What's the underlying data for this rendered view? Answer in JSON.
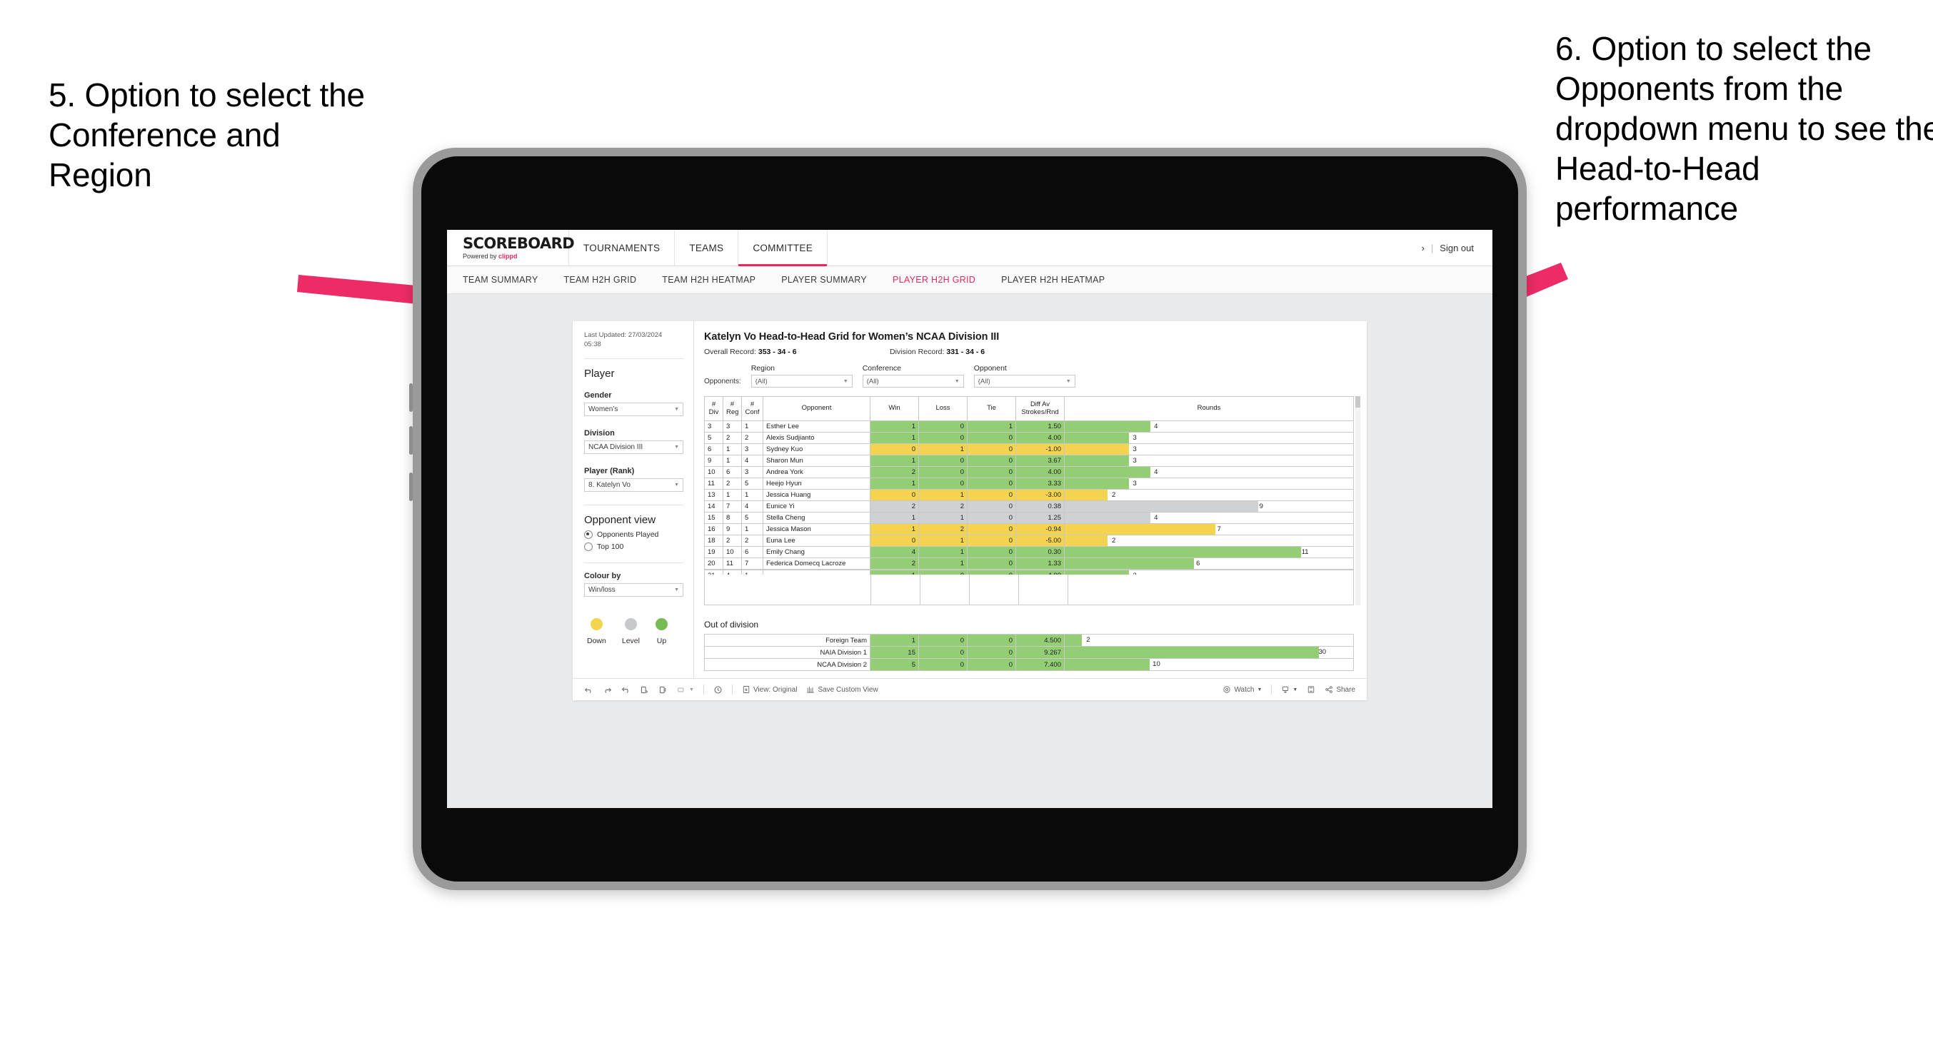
{
  "annotations": {
    "left": "5. Option to select the Conference and Region",
    "right": "6. Option to select the Opponents from the dropdown menu to see the Head-to-Head performance",
    "arrow_color": "#ED2C67"
  },
  "appbar": {
    "logo": "SCOREBOARD",
    "logo_sub_prefix": "Powered by ",
    "logo_sub_brand": "clippd",
    "nav": [
      {
        "label": "TOURNAMENTS",
        "active": false
      },
      {
        "label": "TEAMS",
        "active": false
      },
      {
        "label": "COMMITTEE",
        "active": true
      }
    ],
    "chevron": "›",
    "separator": "|",
    "signout": "Sign out"
  },
  "subnav": {
    "items": [
      {
        "label": "TEAM SUMMARY",
        "active": false
      },
      {
        "label": "TEAM H2H GRID",
        "active": false
      },
      {
        "label": "TEAM H2H HEATMAP",
        "active": false
      },
      {
        "label": "PLAYER SUMMARY",
        "active": false
      },
      {
        "label": "PLAYER H2H GRID",
        "active": true
      },
      {
        "label": "PLAYER H2H HEATMAP",
        "active": false
      }
    ],
    "active_color": "#E8285D"
  },
  "sidebar": {
    "last_updated_line1": "Last Updated: 27/03/2024",
    "last_updated_line2": "05:38",
    "player_heading": "Player",
    "gender_label": "Gender",
    "gender_value": "Women’s",
    "division_label": "Division",
    "division_value": "NCAA Division III",
    "player_rank_label": "Player (Rank)",
    "player_rank_value": "8. Katelyn Vo",
    "opponent_view_heading": "Opponent view",
    "opponent_view_options": [
      {
        "label": "Opponents Played",
        "selected": true
      },
      {
        "label": "Top 100",
        "selected": false
      }
    ],
    "colour_by_label": "Colour by",
    "colour_by_value": "Win/loss",
    "legend": [
      {
        "label": "Down",
        "color": "#F2D44E"
      },
      {
        "label": "Level",
        "color": "#C5C9CC"
      },
      {
        "label": "Up",
        "color": "#76BC52"
      }
    ]
  },
  "main": {
    "title": "Katelyn Vo Head-to-Head Grid for Women’s NCAA Division III",
    "overall_record_label": "Overall Record: ",
    "overall_record_value": "353 - 34 - 6",
    "division_record_label": "Division Record: ",
    "division_record_value": "331 - 34 - 6",
    "filters_label": "Opponents:",
    "filters": [
      {
        "name": "Region",
        "value": "(All)"
      },
      {
        "name": "Conference",
        "value": "(All)"
      },
      {
        "name": "Opponent",
        "value": "(All)"
      }
    ],
    "columns": [
      {
        "l1": "#",
        "l2": "Div"
      },
      {
        "l1": "#",
        "l2": "Reg"
      },
      {
        "l1": "#",
        "l2": "Conf"
      },
      {
        "l1": "Opponent",
        "l2": ""
      },
      {
        "l1": "Win",
        "l2": ""
      },
      {
        "l1": "Loss",
        "l2": ""
      },
      {
        "l1": "Tie",
        "l2": ""
      },
      {
        "l1": "Diff Av",
        "l2": "Strokes/Rnd"
      },
      {
        "l1": "Rounds",
        "l2": ""
      }
    ],
    "rows": [
      {
        "div": "3",
        "reg": "3",
        "conf": "1",
        "opponent": "Esther Lee",
        "win": "1",
        "loss": "0",
        "tie": "1",
        "diff": "1.50",
        "rounds": "4",
        "status": "up"
      },
      {
        "div": "5",
        "reg": "2",
        "conf": "2",
        "opponent": "Alexis Sudjianto",
        "win": "1",
        "loss": "0",
        "tie": "0",
        "diff": "4.00",
        "rounds": "3",
        "status": "up"
      },
      {
        "div": "6",
        "reg": "1",
        "conf": "3",
        "opponent": "Sydney Kuo",
        "win": "0",
        "loss": "1",
        "tie": "0",
        "diff": "-1.00",
        "rounds": "3",
        "status": "down"
      },
      {
        "div": "9",
        "reg": "1",
        "conf": "4",
        "opponent": "Sharon Mun",
        "win": "1",
        "loss": "0",
        "tie": "0",
        "diff": "3.67",
        "rounds": "3",
        "status": "up"
      },
      {
        "div": "10",
        "reg": "6",
        "conf": "3",
        "opponent": "Andrea York",
        "win": "2",
        "loss": "0",
        "tie": "0",
        "diff": "4.00",
        "rounds": "4",
        "status": "up"
      },
      {
        "div": "11",
        "reg": "2",
        "conf": "5",
        "opponent": "Heejo Hyun",
        "win": "1",
        "loss": "0",
        "tie": "0",
        "diff": "3.33",
        "rounds": "3",
        "status": "up"
      },
      {
        "div": "13",
        "reg": "1",
        "conf": "1",
        "opponent": "Jessica Huang",
        "win": "0",
        "loss": "1",
        "tie": "0",
        "diff": "-3.00",
        "rounds": "2",
        "status": "down"
      },
      {
        "div": "14",
        "reg": "7",
        "conf": "4",
        "opponent": "Eunice Yi",
        "win": "2",
        "loss": "2",
        "tie": "0",
        "diff": "0.38",
        "rounds": "9",
        "status": "level"
      },
      {
        "div": "15",
        "reg": "8",
        "conf": "5",
        "opponent": "Stella Cheng",
        "win": "1",
        "loss": "1",
        "tie": "0",
        "diff": "1.25",
        "rounds": "4",
        "status": "level"
      },
      {
        "div": "16",
        "reg": "9",
        "conf": "1",
        "opponent": "Jessica Mason",
        "win": "1",
        "loss": "2",
        "tie": "0",
        "diff": "-0.94",
        "rounds": "7",
        "status": "down"
      },
      {
        "div": "18",
        "reg": "2",
        "conf": "2",
        "opponent": "Euna Lee",
        "win": "0",
        "loss": "1",
        "tie": "0",
        "diff": "-5.00",
        "rounds": "2",
        "status": "down"
      },
      {
        "div": "19",
        "reg": "10",
        "conf": "6",
        "opponent": "Emily Chang",
        "win": "4",
        "loss": "1",
        "tie": "0",
        "diff": "0.30",
        "rounds": "11",
        "status": "up"
      },
      {
        "div": "20",
        "reg": "11",
        "conf": "7",
        "opponent": "Federica Domecq Lacroze",
        "win": "2",
        "loss": "1",
        "tie": "0",
        "diff": "1.33",
        "rounds": "6",
        "status": "up"
      }
    ],
    "out_of_division_title": "Out of division",
    "out_of_division_rows": [
      {
        "name": "Foreign Team",
        "win": "1",
        "loss": "0",
        "tie": "0",
        "diff": "4.500",
        "rounds": "2",
        "status": "up"
      },
      {
        "name": "NAIA Division 1",
        "win": "15",
        "loss": "0",
        "tie": "0",
        "diff": "9.267",
        "rounds": "30",
        "status": "up"
      },
      {
        "name": "NCAA Division 2",
        "win": "5",
        "loss": "0",
        "tie": "0",
        "diff": "7.400",
        "rounds": "10",
        "status": "up"
      }
    ],
    "status_colors": {
      "up": "#93CE74",
      "down": "#F4D44E",
      "level": "#CFD2D4"
    }
  },
  "toolbar": {
    "view_label": "View: Original",
    "save_label": "Save Custom View",
    "watch_label": "Watch",
    "share_label": "Share"
  }
}
